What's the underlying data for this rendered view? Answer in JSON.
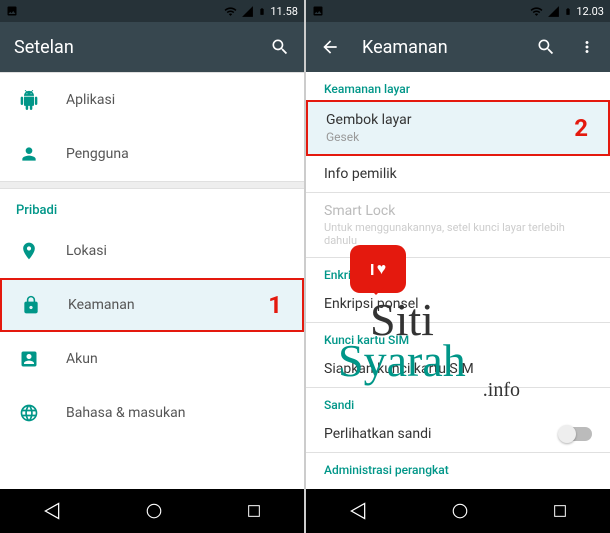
{
  "left": {
    "status_time": "11.58",
    "appbar_title": "Setelan",
    "rows": {
      "apps": "Aplikasi",
      "users": "Pengguna"
    },
    "section_personal": "Pribadi",
    "rows2": {
      "location": "Lokasi",
      "security": "Keamanan",
      "accounts": "Akun",
      "language": "Bahasa & masukan"
    },
    "highlight_num": "1"
  },
  "right": {
    "status_time": "12.03",
    "appbar_title": "Keamanan",
    "section_screen": "Keamanan layar",
    "screenlock_title": "Gembok layar",
    "screenlock_sub": "Gesek",
    "owner_info": "Info pemilik",
    "smartlock_title": "Smart Lock",
    "smartlock_sub": "Untuk menggunakannya, setel kunci layar terlebih dahulu",
    "section_encrypt": "Enkripsi",
    "encrypt_phone": "Enkripsi ponsel",
    "section_sim": "Kunci kartu SIM",
    "sim_setup": "Siapkan kunci kartu SIM",
    "section_pass": "Sandi",
    "show_pass": "Perlihatkan sandi",
    "section_admin": "Administrasi perangkat",
    "highlight_num": "2"
  },
  "watermark": {
    "bubble": "I ♥",
    "line1": "Siti",
    "line2": "Syarah",
    "line3": ".info"
  }
}
